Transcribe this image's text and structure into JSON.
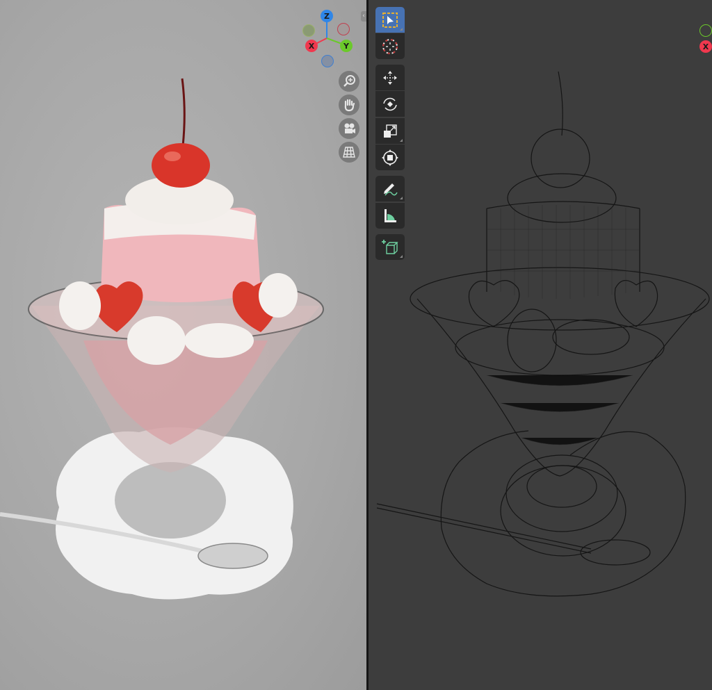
{
  "left_viewport": {
    "shading": "rendered",
    "gizmo": {
      "x_label": "X",
      "y_label": "Y",
      "z_label": "Z"
    },
    "nav_buttons": [
      "zoom-icon",
      "pan-hand-icon",
      "camera-icon",
      "orthographic-grid-icon"
    ]
  },
  "right_viewport": {
    "shading": "wireframe",
    "gizmo": {
      "x_label": "X"
    },
    "toolbar": [
      {
        "name": "select-box",
        "active": true
      },
      {
        "name": "cursor",
        "active": false
      },
      {
        "name": "move",
        "active": false
      },
      {
        "name": "rotate",
        "active": false
      },
      {
        "name": "scale",
        "active": false
      },
      {
        "name": "transform",
        "active": false
      },
      {
        "name": "annotate",
        "active": false
      },
      {
        "name": "measure",
        "active": false
      },
      {
        "name": "add-cube",
        "active": false
      }
    ]
  },
  "colors": {
    "accent": "#4772b3",
    "axis_x": "#f0384e",
    "axis_y": "#6bc92a",
    "axis_z": "#2f86e8",
    "tool_green": "#6ecfa0"
  }
}
